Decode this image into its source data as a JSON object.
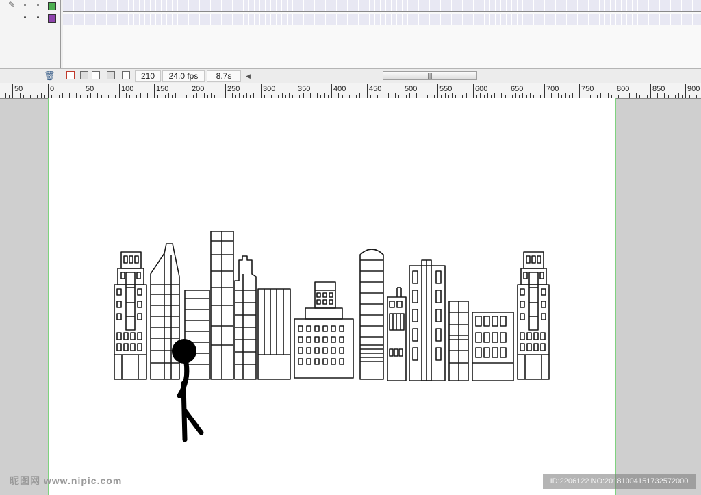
{
  "timeline": {
    "layers": [
      {
        "color": "#4caf50"
      },
      {
        "color": "#8e44ad"
      }
    ]
  },
  "status": {
    "current_frame": "210",
    "frame_rate": "24.0 fps",
    "elapsed_time": "8.7s",
    "scroll_grip": "|||"
  },
  "ruler": {
    "labels": [
      "50",
      "0",
      "50",
      "100",
      "150",
      "200",
      "250",
      "300",
      "350",
      "400",
      "450",
      "500",
      "550",
      "600",
      "650",
      "700",
      "750",
      "800",
      "850",
      "900"
    ]
  },
  "watermark": {
    "left": "昵图网 www.nipic.com",
    "right": "ID:2206122 NO:20181004151732572000"
  },
  "colors": {
    "playhead": "#c0392b",
    "stage_border": "#7fd27f"
  }
}
